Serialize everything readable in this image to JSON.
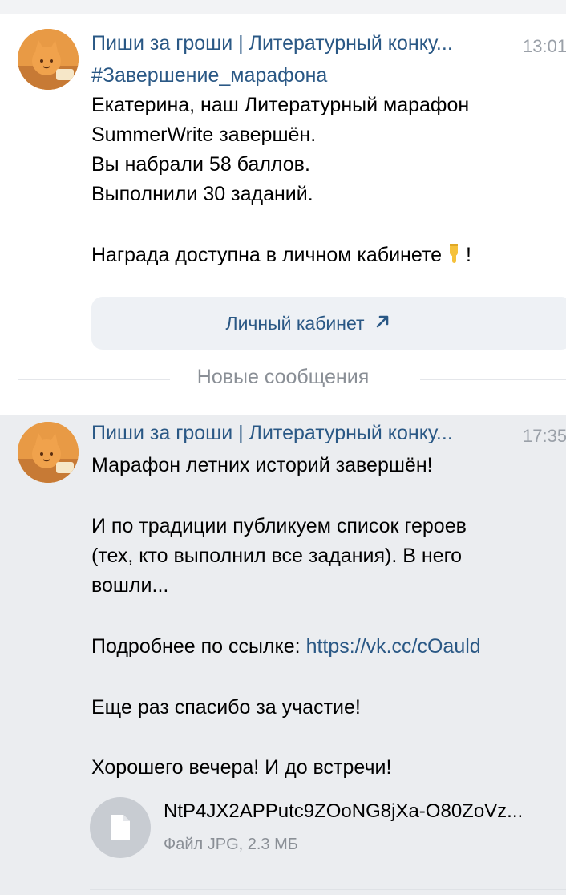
{
  "messages": [
    {
      "author": "Пиши за гроши | Литературный конку...",
      "time": "13:01",
      "hashtag": "#Завершение_марафона",
      "lines": [
        "Екатерина, наш Литературный марафон",
        "SummerWrite завершён.",
        "Вы набрали 58 баллов.",
        "Выполнили 30 заданий."
      ],
      "reward_text": "Награда доступна в личном кабинете",
      "reward_suffix": "!",
      "emoji_icon": "pointing-down-hand-icon",
      "button_label": "Личный кабинет"
    },
    {
      "author": "Пиши за гроши | Литературный конку...",
      "time": "17:35",
      "lines": [
        "Марафон летних историй завершён!",
        "",
        "И по традиции публикуем список героев",
        "(тех, кто выполнил все задания). В него",
        "вошли..."
      ],
      "link_prefix": "Подробнее по ссылке:",
      "link_url": "https://vk.cc/cOauld",
      "thanks": "Еще раз спасибо за участие!",
      "goodbye": "Хорошего вечера! И до встречи!",
      "attachment": {
        "name": "NtP4JX2APPutc9ZOoNG8jXa-O80ZoVz...",
        "meta": "Файл JPG, 2.3 МБ"
      }
    }
  ],
  "divider_label": "Новые сообщения",
  "colors": {
    "link": "#2a5885",
    "new_bg": "#ebedf0",
    "meta": "#8a8f96"
  }
}
